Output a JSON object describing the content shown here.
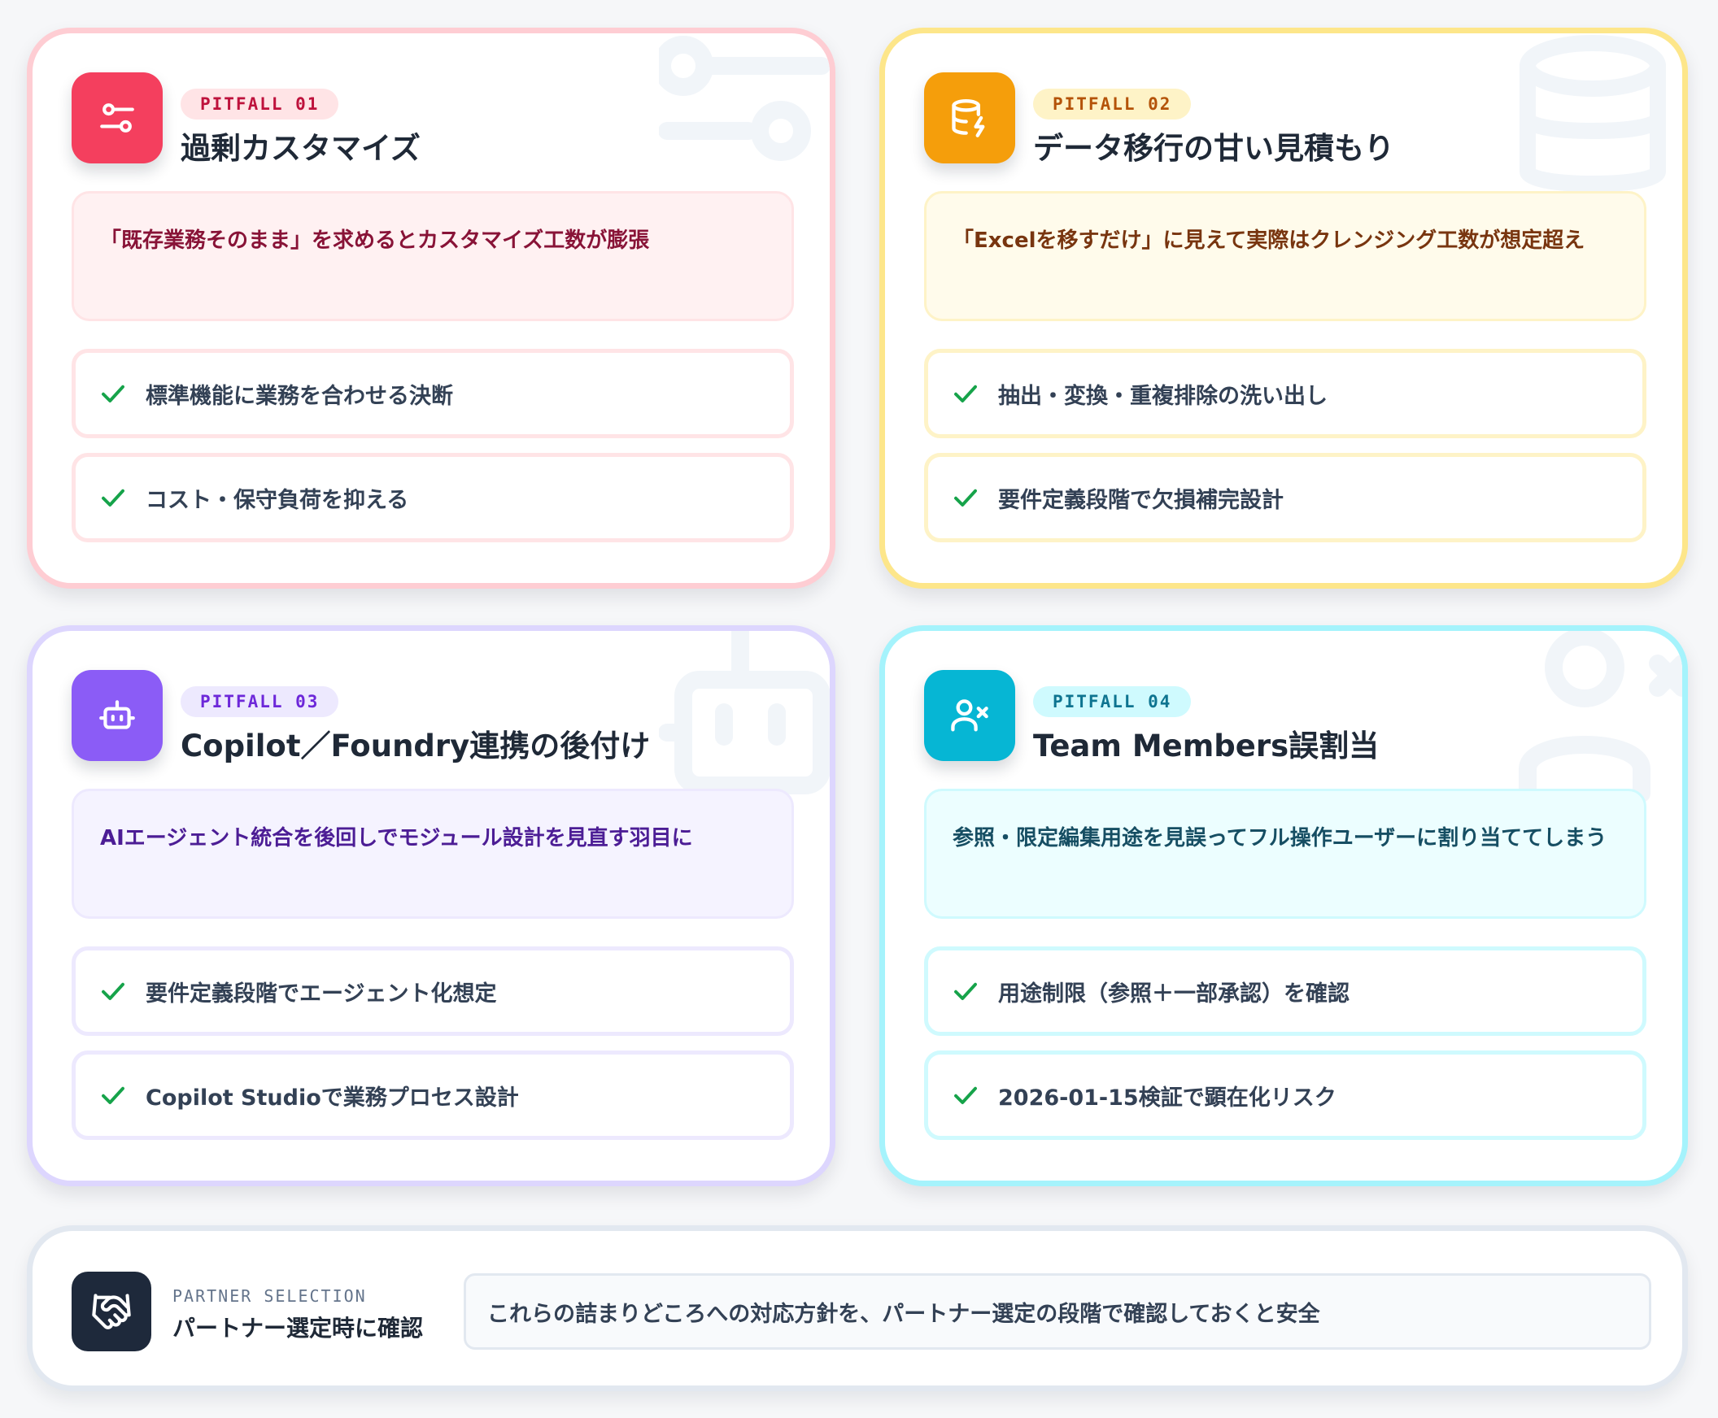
{
  "colors": {
    "pitfall_01": "#f43f5e",
    "pitfall_02": "#f59e0b",
    "pitfall_03": "#8b5cf6",
    "pitfall_04": "#06b6d4",
    "check": "#16a34a",
    "partner_icon_bg": "#1e293b"
  },
  "cards": [
    {
      "tag": "PITFALL 01",
      "icon": "sliders-icon",
      "title": "過剰カスタマイズ",
      "problem": "「既存業務そのまま」を求めるとカスタマイズ工数が膨張",
      "checks": [
        "標準機能に業務を合わせる決断",
        "コスト・保守負荷を抑える"
      ]
    },
    {
      "tag": "PITFALL 02",
      "icon": "database-bolt-icon",
      "title": "データ移行の甘い見積もり",
      "problem": "「Excelを移すだけ」に見えて実際はクレンジング工数が想定超え",
      "checks": [
        "抽出・変換・重複排除の洗い出し",
        "要件定義段階で欠損補完設計"
      ]
    },
    {
      "tag": "PITFALL 03",
      "icon": "bot-icon",
      "title": "Copilot／Foundry連携の後付け",
      "problem": "AIエージェント統合を後回しでモジュール設計を見直す羽目に",
      "checks": [
        "要件定義段階でエージェント化想定",
        "Copilot Studioで業務プロセス設計"
      ]
    },
    {
      "tag": "PITFALL 04",
      "icon": "user-x-icon",
      "title": "Team Members誤割当",
      "problem": "参照・限定編集用途を見誤ってフル操作ユーザーに割り当ててしまう",
      "checks": [
        "用途制限（参照＋一部承認）を確認",
        "2026-01-15検証で顕在化リスク"
      ]
    }
  ],
  "partner": {
    "icon": "handshake-icon",
    "eyebrow": "PARTNER SELECTION",
    "title": "パートナー選定時に確認",
    "note": "これらの詰まりどころへの対応方針を、パートナー選定の段階で確認しておくと安全"
  }
}
